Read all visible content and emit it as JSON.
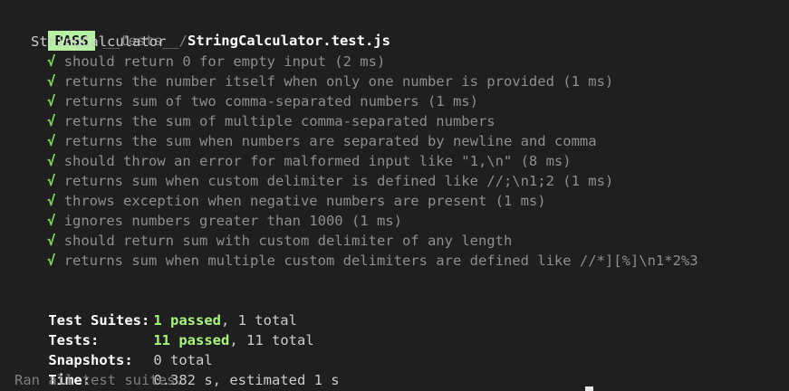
{
  "header": {
    "badge": "PASS",
    "path_dir": "__tests__/",
    "path_file": "StringCalculator.test.js"
  },
  "suite": {
    "name": "StringCalculator",
    "check_glyph": "√",
    "tests": [
      "should return 0 for empty input (2 ms)",
      "returns the number itself when only one number is provided (1 ms)",
      "returns sum of two comma-separated numbers (1 ms)",
      "returns the sum of multiple comma-separated numbers",
      "returns the sum when numbers are separated by newline and comma",
      "should throw an error for malformed input like \"1,\\n\" (8 ms)",
      "returns sum when custom delimiter is defined like //;\\n1;2 (1 ms)",
      "throws exception when negative numbers are present (1 ms)",
      "ignores numbers greater than 1000 (1 ms)",
      "should return sum with custom delimiter of any length",
      "returns sum when multiple custom delimiters are defined like //*][%]\\n1*2%3"
    ]
  },
  "summary": {
    "suites_label": "Test Suites:",
    "suites_passed": "1 passed",
    "suites_total": ", 1 total",
    "tests_label": "Tests:",
    "tests_passed": "11 passed",
    "tests_total": ", 11 total",
    "snapshots_label": "Snapshots:",
    "snapshots_value": "0 total",
    "time_label": "Time:",
    "time_value": "0.382 s, estimated 1 s",
    "ran_all": "Ran all test suites."
  }
}
